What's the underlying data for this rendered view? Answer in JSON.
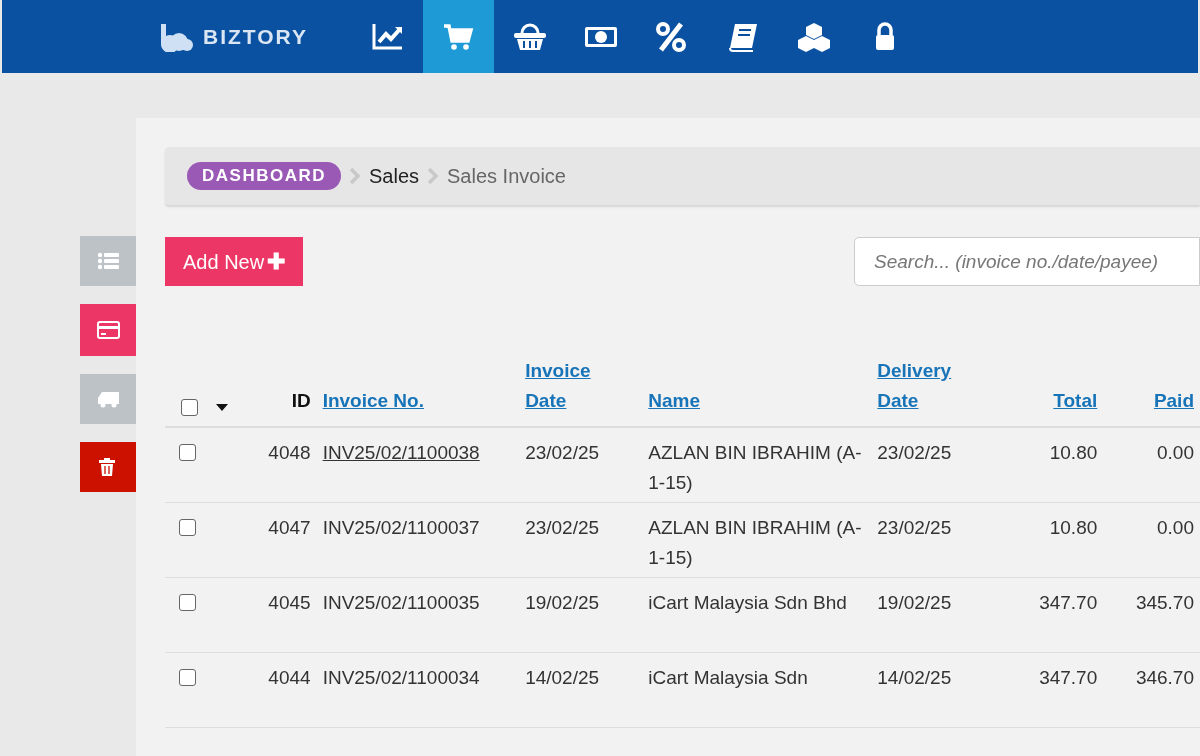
{
  "brand": "BIZTORY",
  "nav": [
    {
      "kind": "chart",
      "selected": false
    },
    {
      "kind": "cart",
      "selected": true
    },
    {
      "kind": "basket",
      "selected": false
    },
    {
      "kind": "money",
      "selected": false
    },
    {
      "kind": "percent",
      "selected": false
    },
    {
      "kind": "book",
      "selected": false
    },
    {
      "kind": "boxes",
      "selected": false
    },
    {
      "kind": "lock",
      "selected": false
    }
  ],
  "side_buttons": [
    {
      "kind": "list",
      "selected": false
    },
    {
      "kind": "card",
      "selected": true
    },
    {
      "kind": "truck",
      "selected": false
    },
    {
      "kind": "trash",
      "selected": false
    }
  ],
  "breadcrumb": [
    {
      "label": "DASHBOARD",
      "kind": "pill"
    },
    {
      "label": "Sales",
      "kind": "link"
    },
    {
      "label": "Sales Invoice",
      "kind": "current"
    }
  ],
  "add_button": "Add New",
  "add_icon": "✚",
  "search": {
    "placeholder": "Search... (invoice no./date/payee)"
  },
  "table": {
    "select_all_checked": false,
    "columns": [
      {
        "label": "ID",
        "sortable": false
      },
      {
        "label": "Invoice No.",
        "sortable": true
      },
      {
        "label": "Invoice Date",
        "sortable": true
      },
      {
        "label": "Name",
        "sortable": true
      },
      {
        "label": "Delivery Date",
        "sortable": true
      },
      {
        "label": "Total",
        "sortable": true
      },
      {
        "label": "Paid",
        "sortable": true
      }
    ],
    "rows": [
      {
        "checked": false,
        "hovered": true,
        "cells": [
          "4048",
          "INV25/02/1100038",
          "23/02/25",
          "AZLAN BIN IBRAHIM (A-1-15)",
          "23/02/25",
          "10.80",
          "0.00"
        ]
      },
      {
        "checked": false,
        "hovered": false,
        "cells": [
          "4047",
          "INV25/02/1100037",
          "23/02/25",
          "AZLAN BIN IBRAHIM (A-1-15)",
          "23/02/25",
          "10.80",
          "0.00"
        ]
      },
      {
        "checked": false,
        "hovered": false,
        "cells": [
          "4045",
          "INV25/02/1100035",
          "19/02/25",
          "iCart Malaysia Sdn Bhd",
          "19/02/25",
          "347.70",
          "345.70"
        ]
      },
      {
        "checked": false,
        "hovered": false,
        "cells": [
          "4044",
          "INV25/02/1100034",
          "14/02/25",
          "iCart Malaysia Sdn",
          "14/02/25",
          "347.70",
          "346.70"
        ]
      }
    ]
  }
}
